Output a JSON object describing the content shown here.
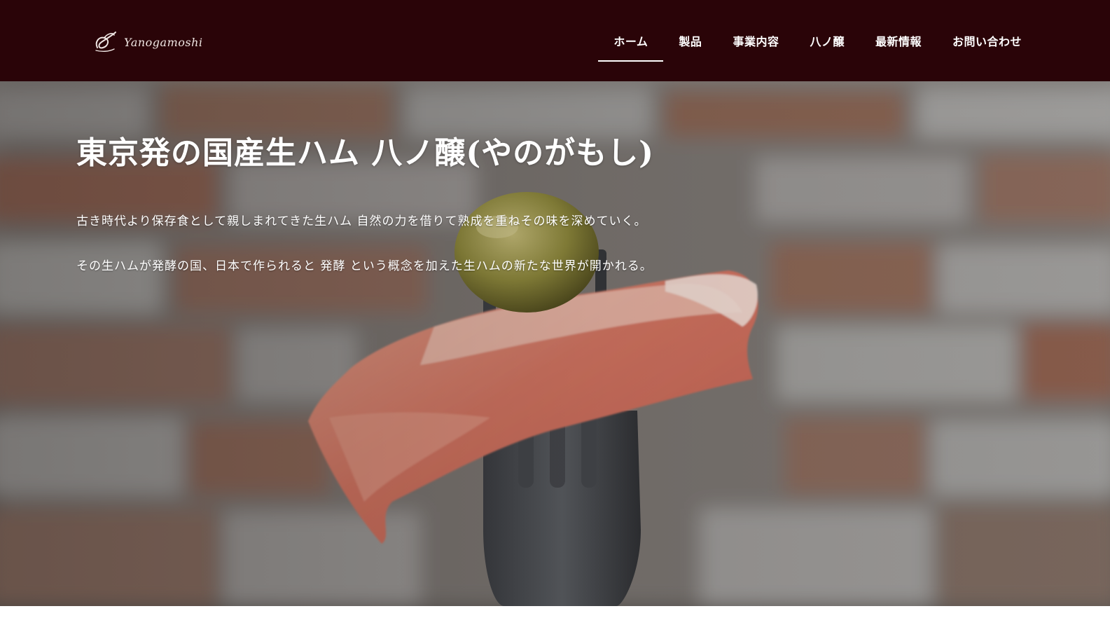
{
  "header": {
    "logo_text": "Yanogamoshi",
    "nav": [
      {
        "label": "ホーム",
        "active": true
      },
      {
        "label": "製品",
        "active": false
      },
      {
        "label": "事業内容",
        "active": false
      },
      {
        "label": "八ノ醸",
        "active": false
      },
      {
        "label": "最新情報",
        "active": false
      },
      {
        "label": "お問い合わせ",
        "active": false
      }
    ]
  },
  "hero": {
    "title": "東京発の国産生ハム 八ノ醸(やのがもし)",
    "line1": "古き時代より保存食として親しまれてきた生ハム 自然の力を借りて熟成を重ねその味を深めていく。",
    "line2": "その生ハムが発酵の国、日本で作られると 発酵 という概念を加えた生ハムの新たな世界が開かれる。",
    "image": "prosciutto-and-olive-on-fork-photo"
  },
  "colors": {
    "header_bg": "#2a0408",
    "nav_text": "#ffffff",
    "hero_text": "#ffffff"
  }
}
